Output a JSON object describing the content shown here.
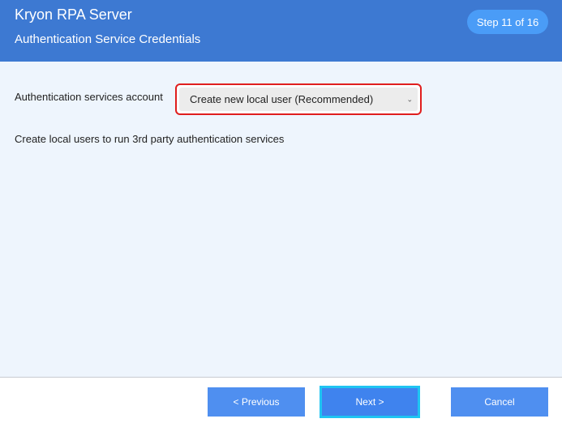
{
  "header": {
    "app_title": "Kryon RPA Server",
    "page_title": "Authentication Service Credentials",
    "step": "Step 11 of 16"
  },
  "form": {
    "account_label": "Authentication services account",
    "account_selected": "Create new local user (Recommended)",
    "description": "Create local users to run 3rd party authentication services"
  },
  "footer": {
    "previous_label": "< Previous",
    "next_label": "Next >",
    "cancel_label": "Cancel"
  },
  "colors": {
    "header_bg": "#3d79d2",
    "step_badge_bg": "#4a9cf7",
    "content_bg": "#eef5fd",
    "button_bg": "#4f8ff0",
    "focus_ring": "#1fc4f2",
    "select_highlight": "#e01e1e"
  }
}
